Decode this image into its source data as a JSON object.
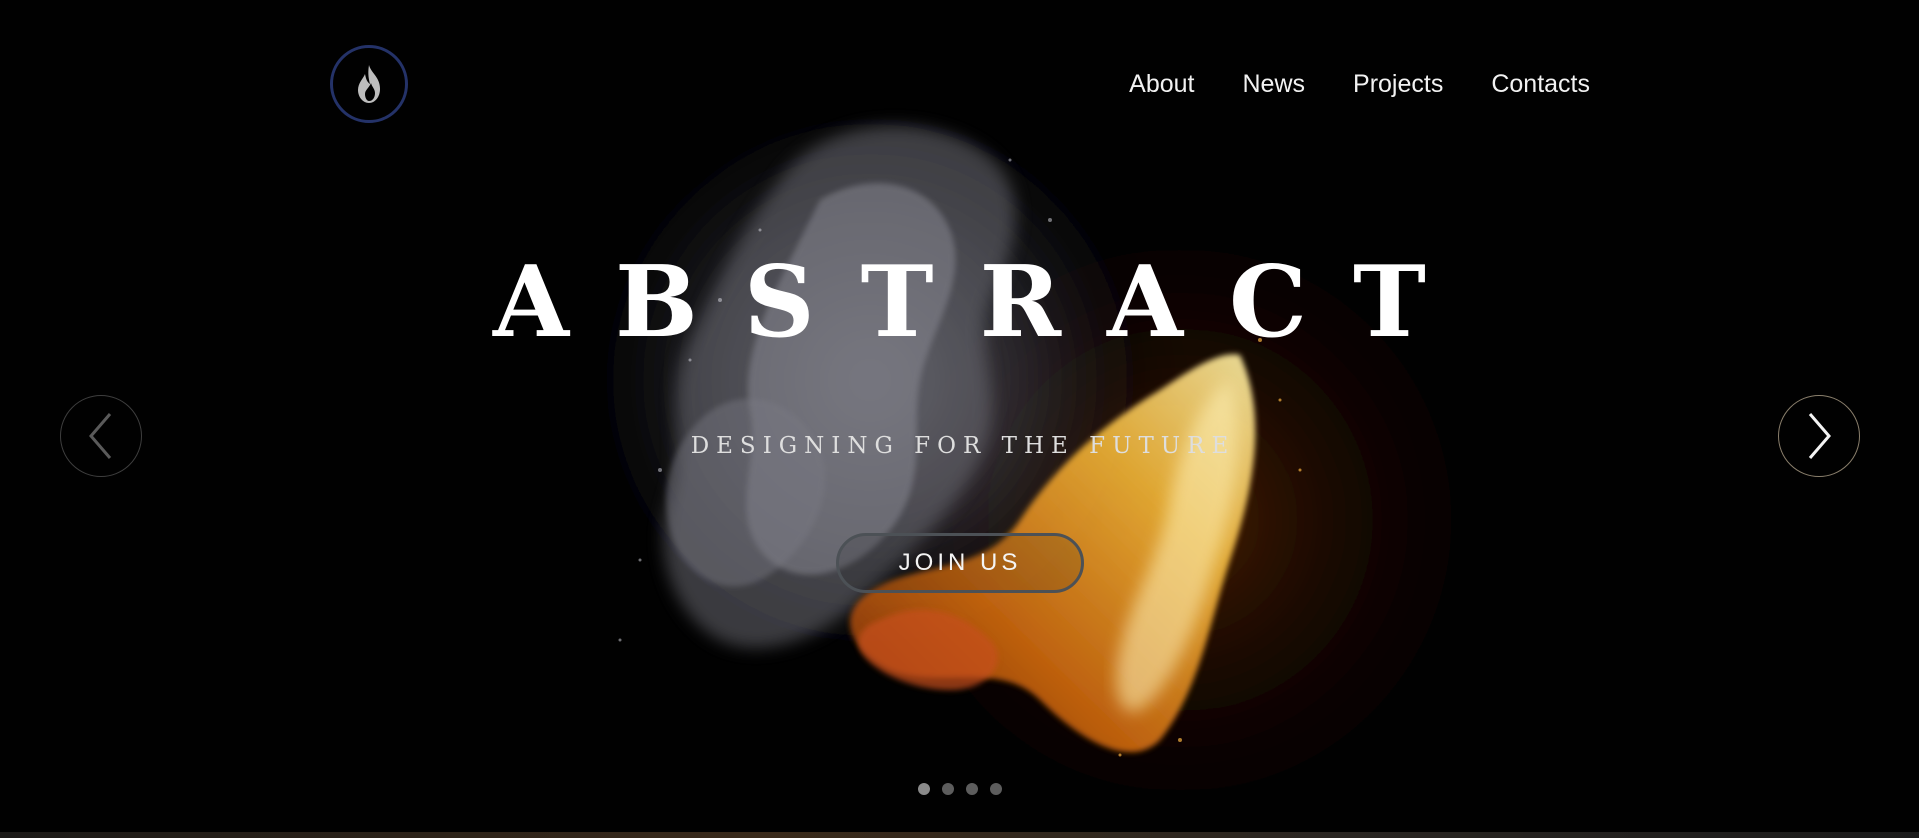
{
  "header": {
    "logo_icon": "flame-icon",
    "nav": [
      {
        "label": "About"
      },
      {
        "label": "News"
      },
      {
        "label": "Projects"
      },
      {
        "label": "Contacts"
      }
    ]
  },
  "hero": {
    "title": "ABSTRACT",
    "subtitle": "DESIGNING FOR THE FUTURE",
    "cta_label": "JOIN US",
    "prev_icon": "chevron-left-icon",
    "next_icon": "chevron-right-icon",
    "slides_total": 4,
    "active_slide": 1
  },
  "colors": {
    "background": "#010101",
    "logo_ring": "#243268",
    "text": "#ffffff",
    "fire": "#f0a020",
    "smoke": "#8e8e96"
  }
}
